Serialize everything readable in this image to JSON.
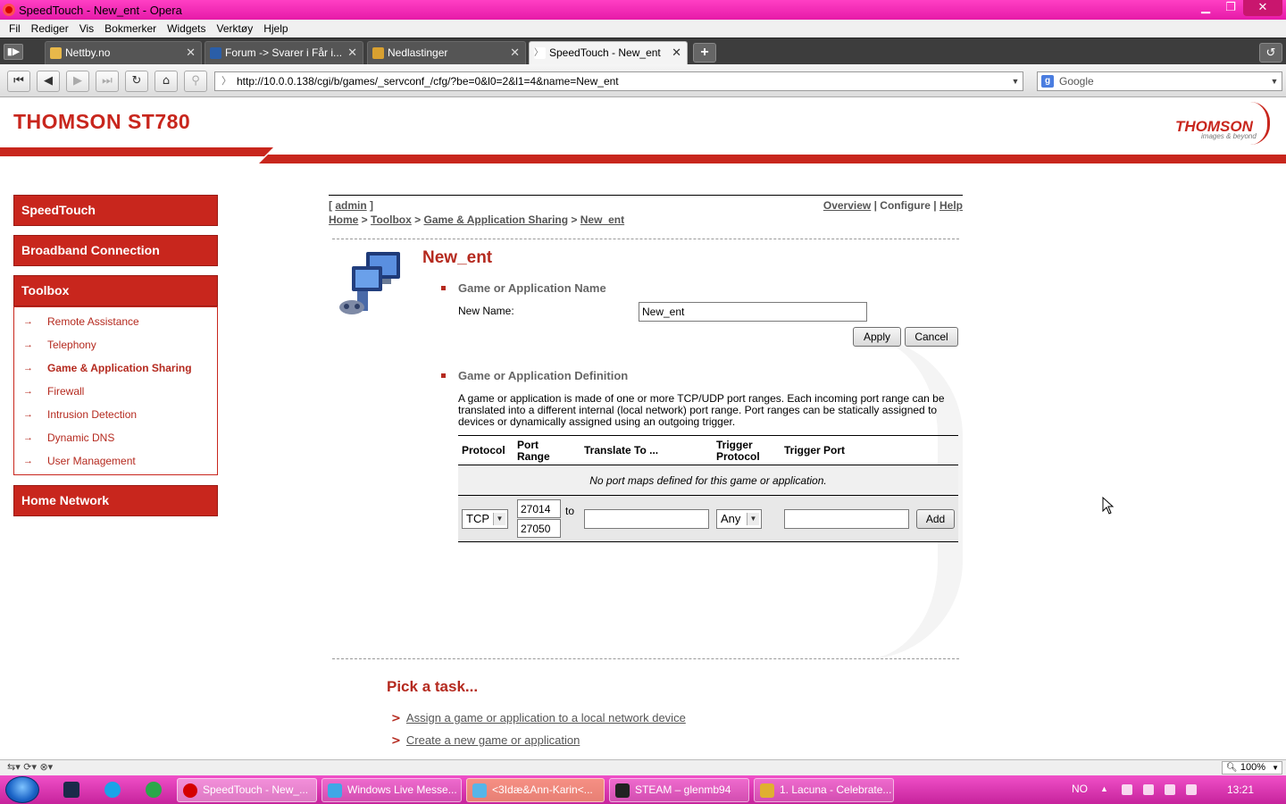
{
  "window": {
    "title": "SpeedTouch - New_ent - Opera"
  },
  "menu": [
    "Fil",
    "Rediger",
    "Vis",
    "Bokmerker",
    "Widgets",
    "Verktøy",
    "Hjelp"
  ],
  "tabs": [
    {
      "label": "Nettby.no"
    },
    {
      "label": "Forum -> Svarer i Får i..."
    },
    {
      "label": "Nedlastinger"
    },
    {
      "label": "SpeedTouch - New_ent"
    }
  ],
  "address": {
    "url": "http://10.0.0.138/cgi/b/games/_servconf_/cfg/?be=0&l0=2&l1=4&name=New_ent"
  },
  "search": {
    "placeholder": "Google"
  },
  "page": {
    "brand": "THOMSON ST780",
    "logo": "THOMSON",
    "logo_sub": "images & beyond",
    "sidebar": {
      "speedtouch": "SpeedTouch",
      "broadband": "Broadband Connection",
      "toolbox": "Toolbox",
      "items": [
        "Remote Assistance",
        "Telephony",
        "Game & Application Sharing",
        "Firewall",
        "Intrusion Detection",
        "Dynamic DNS",
        "User Management"
      ],
      "home_network": "Home Network"
    },
    "user": "admin",
    "breadcrumb": [
      "Home",
      "Toolbox",
      "Game & Application Sharing",
      "New_ent"
    ],
    "toplinks": [
      "Overview",
      "Configure",
      "Help"
    ],
    "title": "New_ent",
    "section1": {
      "heading": "Game or Application Name",
      "new_name_label": "New Name:",
      "new_name_value": "New_ent",
      "apply": "Apply",
      "cancel": "Cancel"
    },
    "section2": {
      "heading": "Game or Application Definition",
      "description": "A game or application is made of one or more TCP/UDP port ranges. Each incoming port range can be translated into a different internal (local network) port range. Port ranges can be statically assigned to devices or dynamically assigned using an outgoing trigger.",
      "columns": {
        "protocol": "Protocol",
        "port_range": "Port Range",
        "translate": "Translate To ...",
        "trigger_protocol": "Trigger Protocol",
        "trigger_port": "Trigger Port"
      },
      "empty_message": "No port maps defined for this game or application.",
      "new_row": {
        "protocol": "TCP",
        "port_from": "27014",
        "to_label": "to",
        "port_to": "27050",
        "translate": "",
        "trigger_protocol": "Any",
        "trigger_port": "",
        "add": "Add"
      }
    },
    "tasks": {
      "title": "Pick a task...",
      "items": [
        "Assign a game or application to a local network device",
        "Create a new game or application"
      ]
    }
  },
  "statusbar": {
    "zoom": "100%"
  },
  "taskbar": {
    "items": [
      {
        "label": "SpeedTouch - New_..."
      },
      {
        "label": "Windows Live Messe..."
      },
      {
        "label": "<3Idæ&Ann-Karin<..."
      },
      {
        "label": "STEAM – glenmb94"
      },
      {
        "label": "1. Lacuna - Celebrate..."
      }
    ],
    "lang": "NO",
    "clock": "13:21"
  }
}
